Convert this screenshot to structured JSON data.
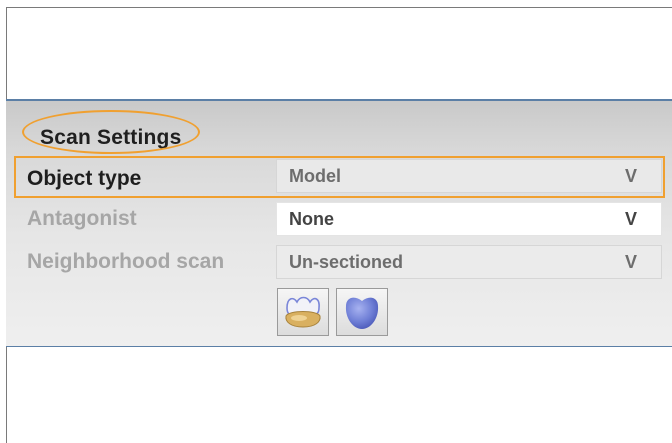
{
  "panel": {
    "title": "Scan Settings"
  },
  "settings": [
    {
      "label": "Object type",
      "value": "Model",
      "arrow": "V",
      "state": "active"
    },
    {
      "label": "Antagonist",
      "value": "None",
      "arrow": "V",
      "state": "inactive"
    },
    {
      "label": "Neighborhood scan",
      "value": "Un-sectioned",
      "arrow": "V",
      "state": "inactive"
    }
  ],
  "icons": [
    {
      "name": "crown-tooth-icon"
    },
    {
      "name": "molar-tooth-icon"
    }
  ],
  "colors": {
    "highlight": "#f0a030",
    "panel_border": "#5b7fa6",
    "tooth_gold": "#d9b060",
    "tooth_blue": "#6f7fd6"
  }
}
